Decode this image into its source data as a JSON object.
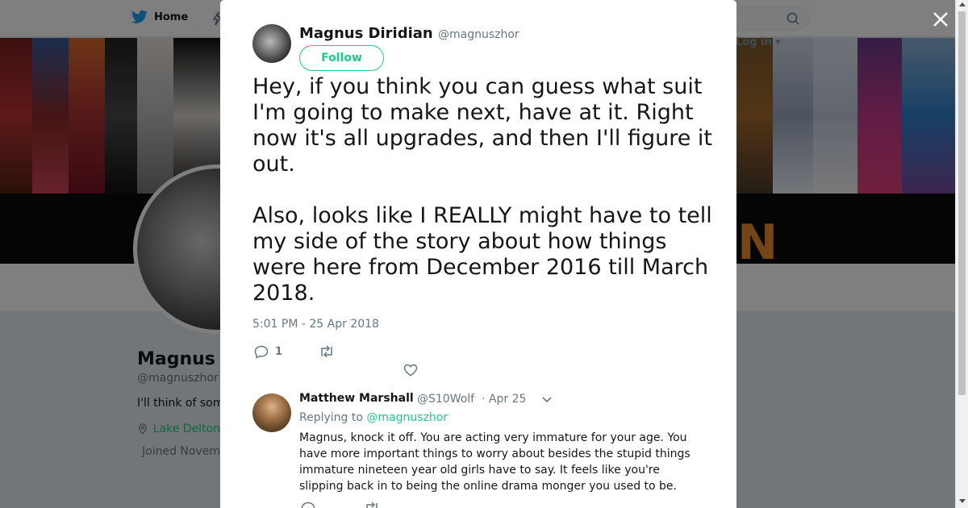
{
  "nav": {
    "home_label": "Home",
    "login_label": "Log in",
    "search_icon": "search-icon"
  },
  "profile": {
    "name": "Magnus Diridian",
    "handle": "@magnuszhor",
    "bio": "I'll think of something",
    "location": "Lake Delton",
    "joined": "Joined November"
  },
  "banner": {
    "letter": "N",
    "accent": "#e88c2a"
  },
  "tweet": {
    "name": "Magnus Diridian",
    "handle": "@magnuszhor",
    "follow_label": "Follow",
    "text": "Hey, if you think you can guess what suit I'm going to make next, have at it. Right now it's all upgrades, and then I'll figure it out.\n\nAlso, looks like I REALLY might have to tell my side of the story about how things were here from December 2016 till March 2018.",
    "timestamp": "5:01 PM - 25 Apr 2018",
    "reply_count": "1",
    "retweet_count": "",
    "like_count": ""
  },
  "reply": {
    "name": "Matthew Marshall",
    "handle": "@S10Wolf",
    "date": "· Apr 25",
    "replying_prefix": "Replying to",
    "replying_to": "@magnuszhor",
    "text": "Magnus, knock it off.  You are acting very immature for your age.  You have more important things to worry about besides the stupid things immature nineteen year old girls have to say.  It feels like you're slipping back in to being the online drama monger you used to be."
  },
  "colors": {
    "accent_green": "#19cf86",
    "twitter_blue": "#1da1f2",
    "muted": "#657786"
  }
}
